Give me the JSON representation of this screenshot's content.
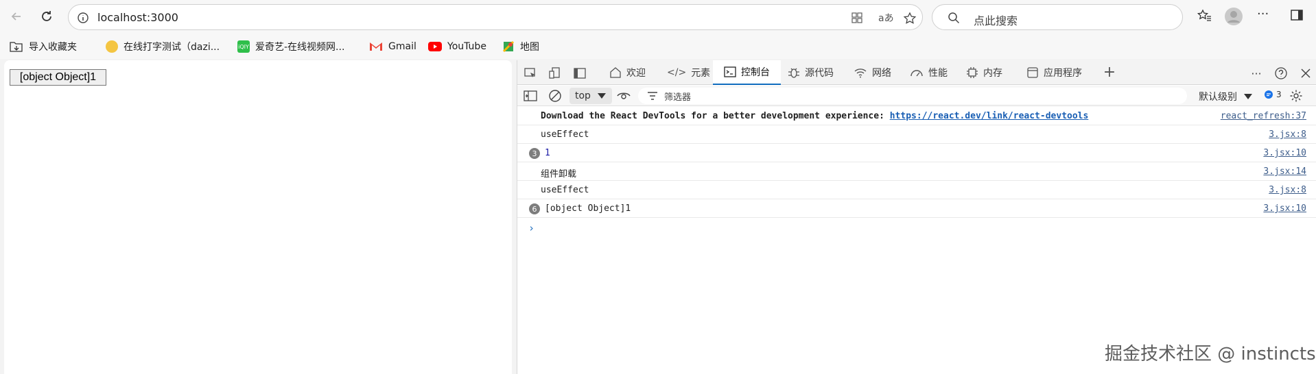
{
  "browser": {
    "url": "localhost:3000",
    "search_placeholder": "点此搜索"
  },
  "bookmarks": [
    {
      "label": "导入收藏夹"
    },
    {
      "label": "在线打字测试（dazi..."
    },
    {
      "label": "爱奇艺-在线视频网..."
    },
    {
      "label": "Gmail"
    },
    {
      "label": "YouTube"
    },
    {
      "label": "地图"
    }
  ],
  "page": {
    "button_label": "[object Object]1"
  },
  "devtools": {
    "tabs": [
      {
        "label": "欢迎"
      },
      {
        "label": "元素"
      },
      {
        "label": "控制台"
      },
      {
        "label": "源代码"
      },
      {
        "label": "网络"
      },
      {
        "label": "性能"
      },
      {
        "label": "内存"
      },
      {
        "label": "应用程序"
      }
    ],
    "context": "top",
    "filter_placeholder": "筛选器",
    "level": "默认级别",
    "issues_count": "3"
  },
  "console": [
    {
      "prefix": "Download the React DevTools for a better development experience: ",
      "link": "https://react.dev/link/react-devtools",
      "source": "react_refresh:37"
    },
    {
      "message": "useEffect",
      "source": "3.jsx:8"
    },
    {
      "count": "3",
      "message": "1",
      "source": "3.jsx:10"
    },
    {
      "message": "组件卸载",
      "source": "3.jsx:14"
    },
    {
      "message": "useEffect",
      "source": "3.jsx:8"
    },
    {
      "count": "6",
      "message": "[object Object]1",
      "source": "3.jsx:10"
    }
  ],
  "watermark": "掘金技术社区 @ instincts",
  "colors": {
    "accent": "#0f6cbd",
    "badge": "#7d7d7d"
  }
}
